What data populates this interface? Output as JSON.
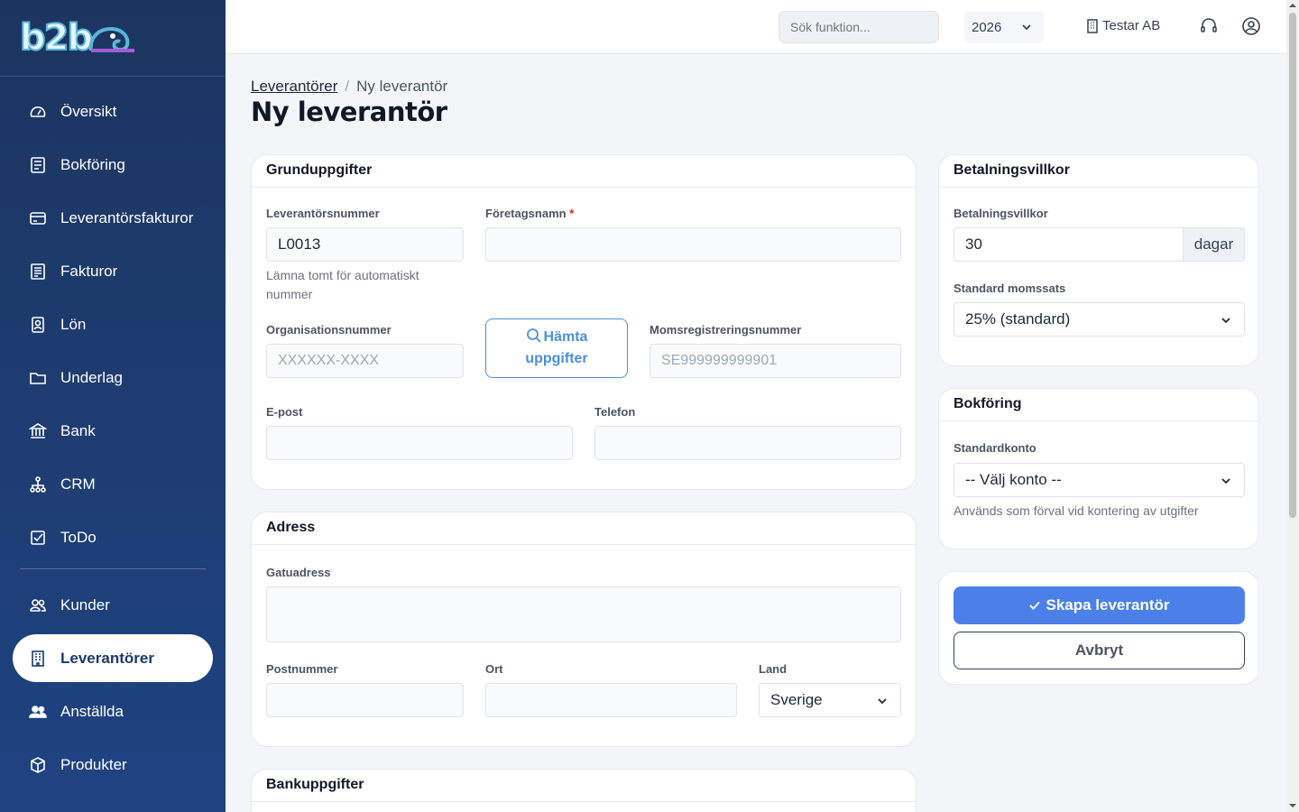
{
  "sidebar": {
    "logo_text": "b2b",
    "items": [
      {
        "label": "Översikt",
        "icon": "gauge-icon"
      },
      {
        "label": "Bokföring",
        "icon": "ledger-icon"
      },
      {
        "label": "Leverantörsfakturor",
        "icon": "credit-card-icon"
      },
      {
        "label": "Fakturor",
        "icon": "invoice-icon"
      },
      {
        "label": "Lön",
        "icon": "badge-icon"
      },
      {
        "label": "Underlag",
        "icon": "folder-icon"
      },
      {
        "label": "Bank",
        "icon": "bank-icon"
      },
      {
        "label": "CRM",
        "icon": "network-icon"
      },
      {
        "label": "ToDo",
        "icon": "checkbox-icon"
      }
    ],
    "items2": [
      {
        "label": "Kunder",
        "icon": "users-icon"
      },
      {
        "label": "Leverantörer",
        "icon": "building-icon",
        "active": true
      },
      {
        "label": "Anställda",
        "icon": "people-icon"
      },
      {
        "label": "Produkter",
        "icon": "box-icon"
      }
    ]
  },
  "topbar": {
    "search_placeholder": "Sök funktion...",
    "year": "2026",
    "company": "Testar AB"
  },
  "breadcrumb": {
    "parent": "Leverantörer",
    "current": "Ny leverantör"
  },
  "page_title": "Ny leverantör",
  "grund": {
    "title": "Grunduppgifter",
    "supplier_number_label": "Leverantörsnummer",
    "supplier_number_value": "L0013",
    "supplier_number_hint": "Lämna tomt för automatiskt nummer",
    "company_name_label": "Företagsnamn",
    "required_mark": "*",
    "org_label": "Organisationsnummer",
    "org_placeholder": "XXXXXX-XXXX",
    "fetch_button_line1": "Hämta",
    "fetch_button_line2": "uppgifter",
    "vat_label": "Momsregistreringsnummer",
    "vat_placeholder": "SE999999999901",
    "email_label": "E-post",
    "phone_label": "Telefon"
  },
  "adress": {
    "title": "Adress",
    "street_label": "Gatuadress",
    "zip_label": "Postnummer",
    "city_label": "Ort",
    "country_label": "Land",
    "country_value": "Sverige"
  },
  "bank": {
    "title": "Bankuppgifter"
  },
  "betalning": {
    "title": "Betalningsvillkor",
    "terms_label": "Betalningsvillkor",
    "terms_value": "30",
    "terms_unit": "dagar",
    "vat_rate_label": "Standard momssats",
    "vat_rate_value": "25% (standard)"
  },
  "bokforing": {
    "title": "Bokföring",
    "account_label": "Standardkonto",
    "account_value": "-- Välj konto --",
    "account_hint": "Används som förval vid kontering av utgifter"
  },
  "actions": {
    "create_label": "Skapa leverantör",
    "cancel_label": "Avbryt"
  },
  "colors": {
    "primary": "#4a80e8",
    "sidebar": "#1f3f7a",
    "fetch": "#4a90d9"
  }
}
